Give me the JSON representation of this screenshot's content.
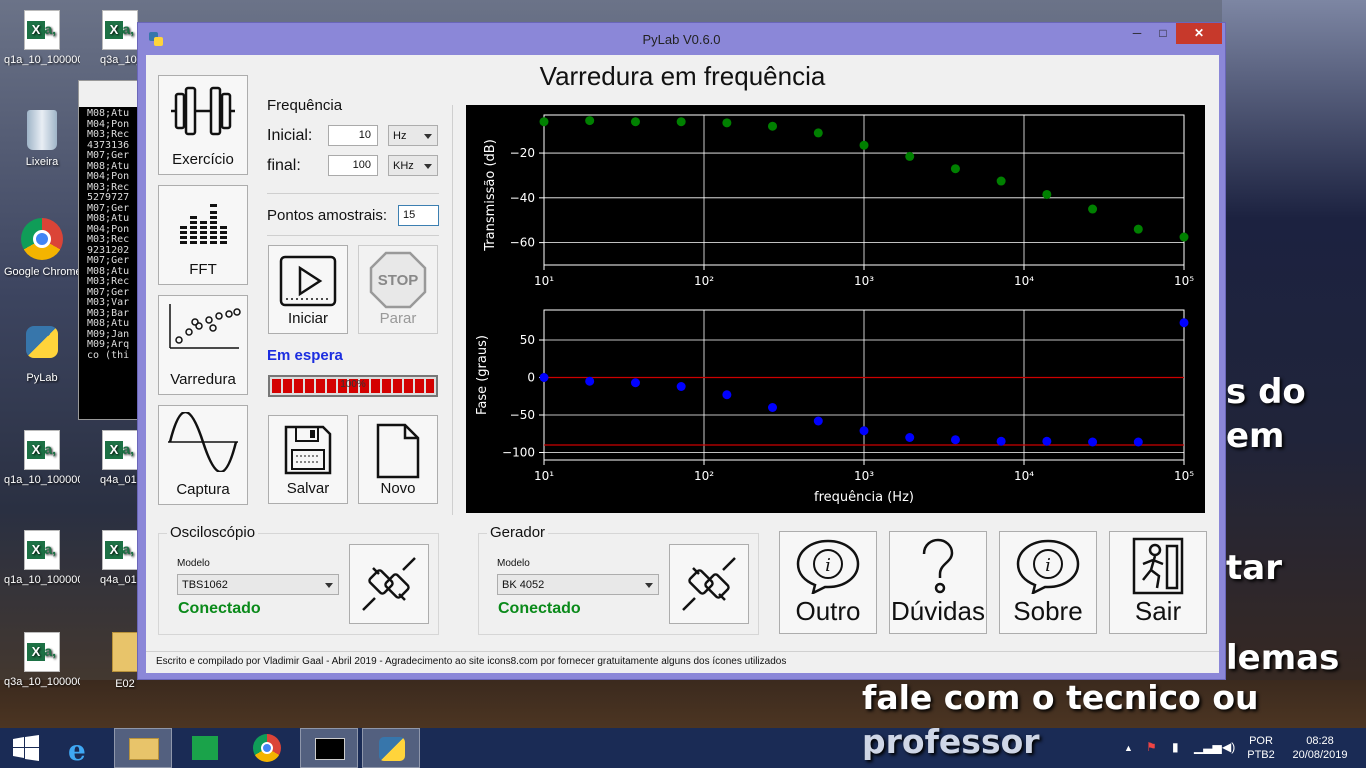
{
  "desktop": {
    "icons": [
      {
        "label": "q1a_10_100000..."
      },
      {
        "label": "q3a_10_1..."
      },
      {
        "label": "Lixeira"
      },
      {
        "label": "Google Chrome"
      },
      {
        "label": "PyLab"
      },
      {
        "label": "q1a_10_100000..."
      },
      {
        "label": "q4a_01..."
      },
      {
        "label": "q1a_10_1000000..."
      },
      {
        "label": "q4a_01u..."
      },
      {
        "label": "q3a_10_100000..."
      },
      {
        "label": "E02"
      }
    ],
    "background_text": [
      "s do",
      "em",
      "tar",
      "lemas",
      "fale com o tecnico ou",
      "professor"
    ],
    "console_lines": "M08;Atu\nM04;Pon\nM03;Rec\n4373136\nM07;Ger\nM08;Atu\nM04;Pon\nM03;Rec\n5279727\nM07;Ger\nM08;Atu\nM04;Pon\nM03;Rec\n9231202\nM07;Ger\nM08;Atu\nM03;Rec\nM07;Ger\nM03;Var\nM03;Bar\nM08;Atu\nM09;Jan\nM09;Arq\nco (thi"
  },
  "window": {
    "title": "PyLab V0.6.0",
    "min_label": "─",
    "max_label": "□",
    "close_label": "✕"
  },
  "app": {
    "heading": "Varredura em frequência",
    "nav": [
      {
        "label": "Exercício",
        "icon": "dumbbell-icon"
      },
      {
        "label": "FFT",
        "icon": "equalizer-icon"
      },
      {
        "label": "Varredura",
        "icon": "scatter-icon"
      },
      {
        "label": "Captura",
        "icon": "waveform-icon"
      }
    ],
    "frequency": {
      "section_label": "Frequência",
      "initial_label": "Inicial:",
      "initial_value": "10",
      "initial_unit": "Hz",
      "final_label": "final:",
      "final_value": "100",
      "final_unit": "KHz",
      "points_label": "Pontos amostrais:",
      "points_value": "15"
    },
    "actions": {
      "start": "Iniciar",
      "stop": "Parar",
      "stop_sign": "STOP",
      "save": "Salvar",
      "new": "Novo"
    },
    "status": "Em espera",
    "progress": {
      "value": 1.0,
      "label": "100%"
    },
    "oscilloscope": {
      "title": "Osciloscópio",
      "model_label": "Modelo",
      "model_value": "TBS1062",
      "status": "Conectado"
    },
    "generator": {
      "title": "Gerador",
      "model_label": "Modelo",
      "model_value": "BK 4052",
      "status": "Conectado"
    },
    "bottom_buttons": [
      {
        "label": "Outro",
        "icon": "info-bubble-icon"
      },
      {
        "label": "Dúvidas",
        "icon": "question-icon"
      },
      {
        "label": "Sobre",
        "icon": "info-bubble-icon"
      },
      {
        "label": "Sair",
        "icon": "exit-icon"
      }
    ],
    "footer": "Escrito e compilado por Vladimir Gaal - Abril 2019 - Agradecimento ao site icons8.com por fornecer gratuitamente alguns dos ícones utilizados"
  },
  "chart_data": [
    {
      "type": "scatter",
      "ylabel": "Transmissão (dB)",
      "xlabel": "",
      "x_scale": "log",
      "xlim": [
        10,
        100000
      ],
      "ylim": [
        -70,
        -3
      ],
      "yticks": [
        -20,
        -40,
        -60
      ],
      "xtick_labels": [
        "10¹",
        "10²",
        "10³",
        "10⁴",
        "10⁵"
      ],
      "grid": true,
      "color": "#008000",
      "x": [
        10,
        19.3,
        37.3,
        72,
        139,
        268,
        518,
        1000,
        1931,
        3728,
        7197,
        13895,
        26827,
        51795,
        100000
      ],
      "y": [
        -6,
        -5.5,
        -6,
        -6,
        -6.5,
        -8,
        -11,
        -16.5,
        -21.5,
        -27,
        -32.5,
        -38.5,
        -45,
        -54,
        -57.5
      ]
    },
    {
      "type": "scatter",
      "ylabel": "Fase (graus)",
      "xlabel": "frequência (Hz)",
      "x_scale": "log",
      "xlim": [
        10,
        100000
      ],
      "ylim": [
        -110,
        90
      ],
      "yticks": [
        50,
        0,
        -50,
        -100
      ],
      "xtick_labels": [
        "10¹",
        "10²",
        "10³",
        "10⁴",
        "10⁵"
      ],
      "grid": true,
      "color": "#0000ff",
      "reference_lines": [
        0,
        -90
      ],
      "reference_color": "#cc0000",
      "x": [
        10,
        19.3,
        37.3,
        72,
        139,
        268,
        518,
        1000,
        1931,
        3728,
        7197,
        13895,
        26827,
        51795,
        100000
      ],
      "y": [
        0,
        -5,
        -7,
        -12,
        -23,
        -40,
        -58,
        -71,
        -80,
        -83,
        -85,
        -85,
        -86,
        -86,
        73
      ]
    }
  ],
  "taskbar": {
    "language": "POR",
    "layout": "PTB2",
    "time": "08:28",
    "date": "20/08/2019"
  }
}
